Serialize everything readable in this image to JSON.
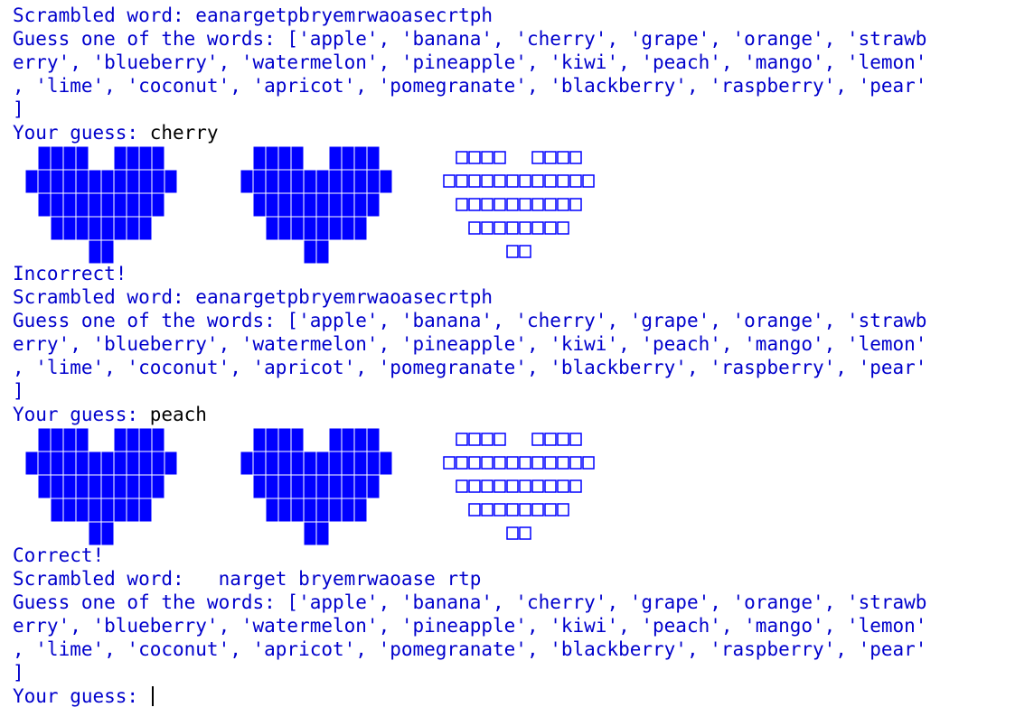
{
  "colors": {
    "text": "#0000cc",
    "input": "#000000",
    "heart_fill": "#0000ff",
    "heart_grid": "#ffffff",
    "background": "#ffffff"
  },
  "session": {
    "rounds": [
      {
        "scrambled_label": "Scrambled word: ",
        "scrambled_value": "eanargetpbryemrwaoasecrtph",
        "guess_lines": [
          "Guess one of the words: ['apple', 'banana', 'cherry', 'grape', 'orange', 'strawb",
          "erry', 'blueberry', 'watermelon', 'pineapple', 'kiwi', 'peach', 'mango', 'lemon'",
          ", 'lime', 'coconut', 'apricot', 'pomegranate', 'blackberry', 'raspberry', 'pear'",
          "]"
        ],
        "prompt": "Your guess: ",
        "guess": "cherry",
        "lives": {
          "filled": 2,
          "empty": 1
        },
        "result": "Incorrect!"
      },
      {
        "scrambled_label": "Scrambled word: ",
        "scrambled_value": "eanargetpbryemrwaoasecrtph",
        "guess_lines": [
          "Guess one of the words: ['apple', 'banana', 'cherry', 'grape', 'orange', 'strawb",
          "erry', 'blueberry', 'watermelon', 'pineapple', 'kiwi', 'peach', 'mango', 'lemon'",
          ", 'lime', 'coconut', 'apricot', 'pomegranate', 'blackberry', 'raspberry', 'pear'",
          "]"
        ],
        "prompt": "Your guess: ",
        "guess": "peach",
        "lives": {
          "filled": 2,
          "empty": 1
        },
        "result": "Correct!"
      },
      {
        "scrambled_label": "Scrambled word: ",
        "scrambled_value": "  narget bryemrwaoase rtp",
        "guess_lines": [
          "Guess one of the words: ['apple', 'banana', 'cherry', 'grape', 'orange', 'strawb",
          "erry', 'blueberry', 'watermelon', 'pineapple', 'kiwi', 'peach', 'mango', 'lemon'",
          ", 'lime', 'coconut', 'apricot', 'pomegranate', 'blackberry', 'raspberry', 'pear'",
          "]"
        ],
        "prompt": "Your guess: ",
        "guess": ""
      }
    ]
  }
}
